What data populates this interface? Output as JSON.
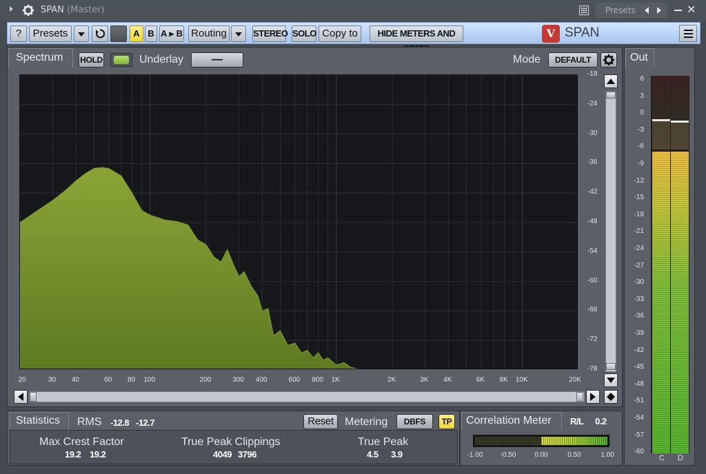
{
  "titlebar": {
    "plugin": "SPAN",
    "track": "(Master)",
    "presets_label": "Presets"
  },
  "toolbar": {
    "help": "?",
    "presets": "Presets",
    "a": "A",
    "b": "B",
    "ab": "A ▸ B",
    "routing": "Routing",
    "stereo": "STEREO",
    "solo": "SOLO",
    "copy_to": "Copy to",
    "hide_meters": "HIDE METERS AND STATS",
    "logo_mark": "V",
    "brand": "SPAN"
  },
  "spectrum": {
    "tab": "Spectrum",
    "hold": "HOLD",
    "underlay_label": "Underlay",
    "underlay_value": "—",
    "mode_label": "Mode",
    "mode_value": "DEFAULT"
  },
  "chart_data": {
    "type": "area",
    "x_scale": "log",
    "xlim": [
      20,
      20000
    ],
    "ylim": [
      -78,
      -18
    ],
    "x_ticks": [
      "20",
      "30",
      "40",
      "60",
      "80",
      "100",
      "200",
      "300",
      "400",
      "600",
      "800",
      "1K",
      "2K",
      "3K",
      "4K",
      "6K",
      "8K",
      "10K",
      "20K"
    ],
    "x_tick_values": [
      20,
      30,
      40,
      60,
      80,
      100,
      200,
      300,
      400,
      600,
      800,
      1000,
      2000,
      3000,
      4000,
      6000,
      8000,
      10000,
      20000
    ],
    "y_ticks": [
      "-18",
      "-24",
      "-30",
      "-36",
      "-42",
      "-48",
      "-54",
      "-60",
      "-66",
      "-72",
      "-78"
    ],
    "y_tick_values": [
      -18,
      -24,
      -30,
      -36,
      -42,
      -48,
      -54,
      -60,
      -66,
      -72,
      -78
    ],
    "grid": true,
    "color": "#7f9a2e",
    "series": [
      {
        "x": [
          20,
          25,
          30,
          35,
          40,
          45,
          50,
          55,
          60,
          70,
          80,
          90,
          100,
          110,
          120,
          140,
          160,
          180,
          200,
          220,
          240,
          260,
          280,
          300,
          320,
          350,
          380,
          400,
          430,
          460,
          500,
          550,
          600,
          650,
          700,
          750,
          800,
          850,
          900,
          1000,
          1100,
          1200,
          1400
        ],
        "y": [
          -48,
          -45.5,
          -43.5,
          -41.5,
          -39.5,
          -38,
          -37,
          -36.8,
          -37,
          -38.5,
          -42,
          -45.5,
          -46.5,
          -47,
          -47.5,
          -47.8,
          -48.5,
          -51.5,
          -52.5,
          -55,
          -56,
          -53.5,
          -56.5,
          -59,
          -58,
          -61,
          -63,
          -66,
          -65.5,
          -71,
          -70,
          -73,
          -72.5,
          -74.5,
          -74,
          -75.5,
          -74.5,
          -76,
          -75.5,
          -77,
          -76.5,
          -77.5,
          -78
        ]
      }
    ]
  },
  "out": {
    "tab": "Out",
    "scale": [
      "6",
      "3",
      "0",
      "-3",
      "-6",
      "-9",
      "-12",
      "-15",
      "-18",
      "-21",
      "-24",
      "-27",
      "-30",
      "-33",
      "-36",
      "-39",
      "-42",
      "-45",
      "-48",
      "-51",
      "-54",
      "-57",
      "-60"
    ],
    "channels": [
      "C",
      "D"
    ]
  },
  "statistics": {
    "tab": "Statistics",
    "rms_label": "RMS",
    "rms_l": "-12.8",
    "rms_r": "-12.7",
    "reset": "Reset",
    "metering_label": "Metering",
    "metering_value": "DBFS",
    "tp": "TP",
    "crest_label": "Max Crest Factor",
    "crest_l": "19.2",
    "crest_r": "19.2",
    "clip_label": "True Peak Clippings",
    "clip_l": "4049",
    "clip_r": "3796",
    "tpeak_label": "True Peak",
    "tpeak_l": "4.5",
    "tpeak_r": "3.9"
  },
  "correlation": {
    "tab": "Correlation Meter",
    "mode": "R/L",
    "value": "0.2",
    "ticks": [
      "-1.00",
      "-0.50",
      "0.00",
      "0.50",
      "1.00"
    ]
  }
}
